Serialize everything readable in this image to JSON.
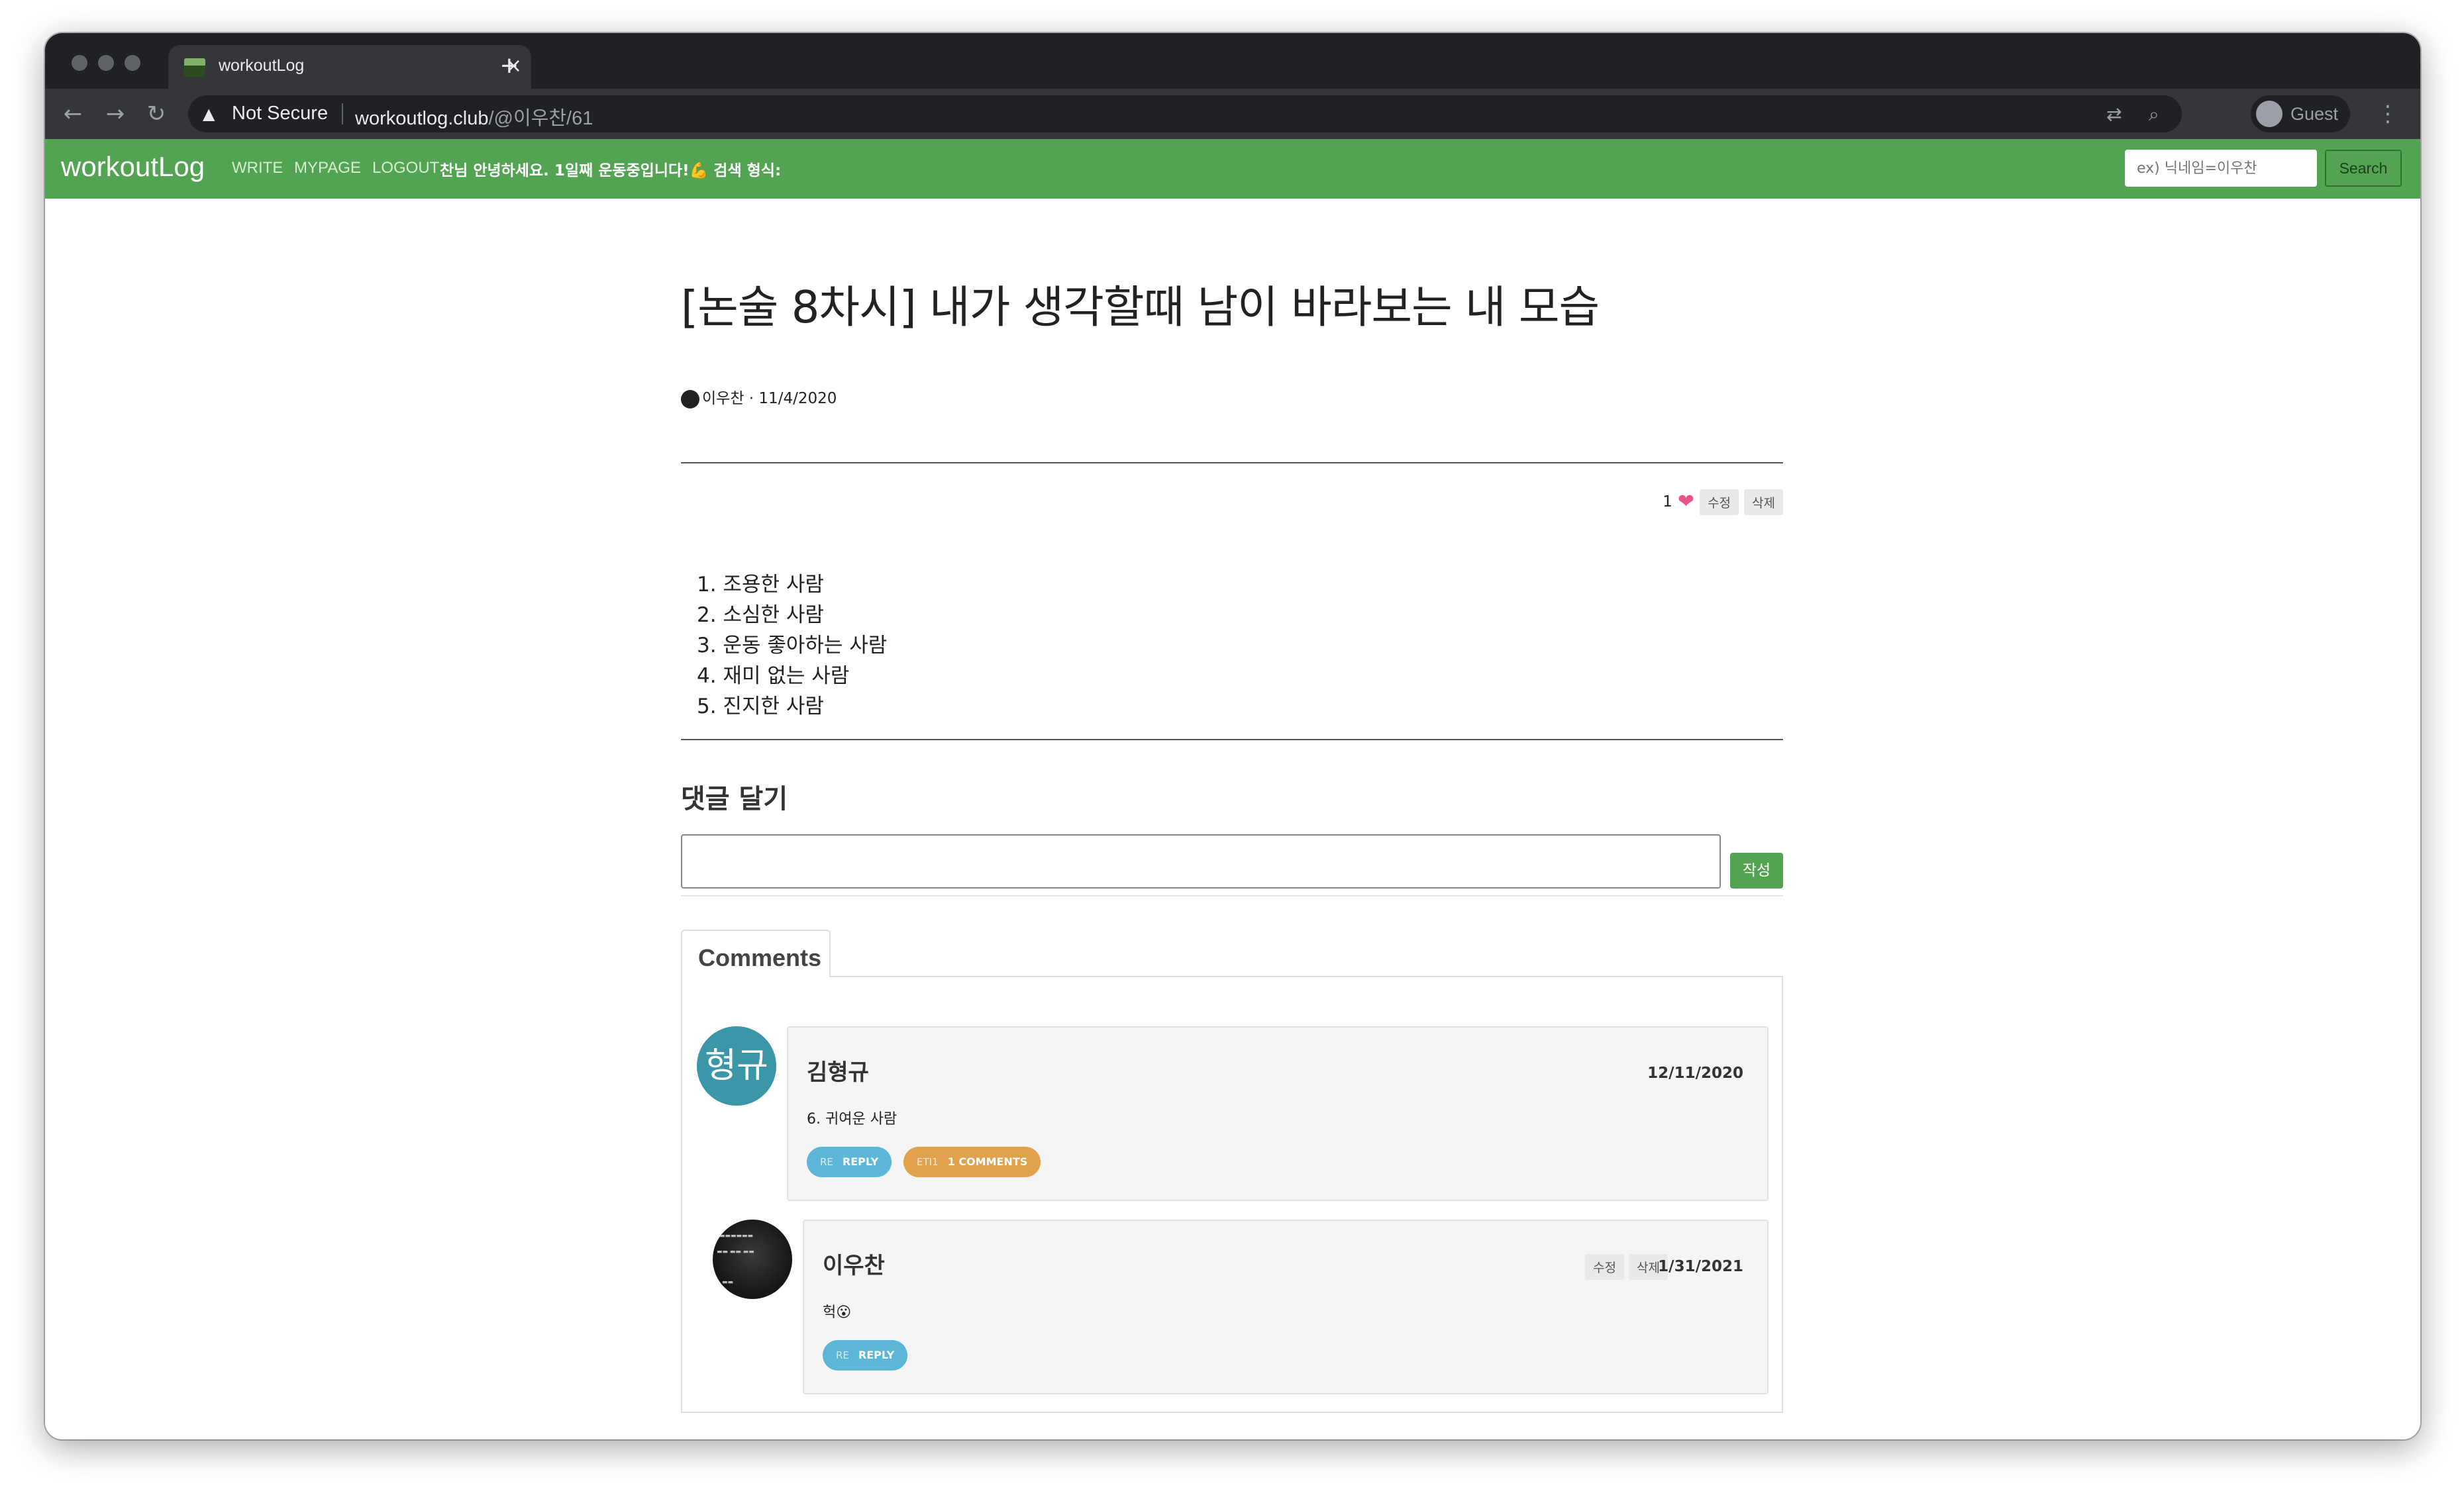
{
  "browser": {
    "tab_title": "workoutLog",
    "tab_close": "×",
    "new_tab": "+",
    "security_label": "Not Secure",
    "url_host": "workoutlog.club",
    "url_path": "/@이우찬/61",
    "profile_label": "Guest"
  },
  "navbar": {
    "brand": "workoutLog",
    "links": [
      "WRITE",
      "MYPAGE",
      "LOGOUT"
    ],
    "greeting": "찬님 안녕하세요. 1일째 운동중입니다!💪 검색 형식:",
    "search_placeholder": "ex) 닉네임=이우찬",
    "search_button": "Search",
    "color": "#52a452"
  },
  "post": {
    "title": "[논술 8차시] 내가 생각할때 남이 바라보는 내 모습",
    "author": "이우찬",
    "date": "11/4/2020",
    "like_count": "1",
    "edit_label": "수정",
    "delete_label": "삭제",
    "body_items": [
      "1. 조용한 사람",
      "2. 소심한 사람",
      "3. 운동 좋아하는 사람",
      "4. 재미 없는 사람",
      "5. 진지한 사람"
    ]
  },
  "comment_form": {
    "heading": "댓글 달기",
    "submit_label": "작성"
  },
  "comments_section": {
    "tab_label": "Comments",
    "comments": [
      {
        "avatar_text": "형규",
        "author": "김형규",
        "date": "12/11/2020",
        "text": "6. 귀여운 사람",
        "reply_prefix": "RE",
        "reply_label": "REPLY",
        "comments_prefix": "ETI1",
        "comments_label": "1 COMMENTS"
      },
      {
        "author": "이우찬",
        "date": "1/31/2021",
        "text": "헉😮",
        "edit_label": "수정",
        "delete_label": "삭제",
        "reply_prefix": "RE",
        "reply_label": "REPLY"
      }
    ]
  }
}
